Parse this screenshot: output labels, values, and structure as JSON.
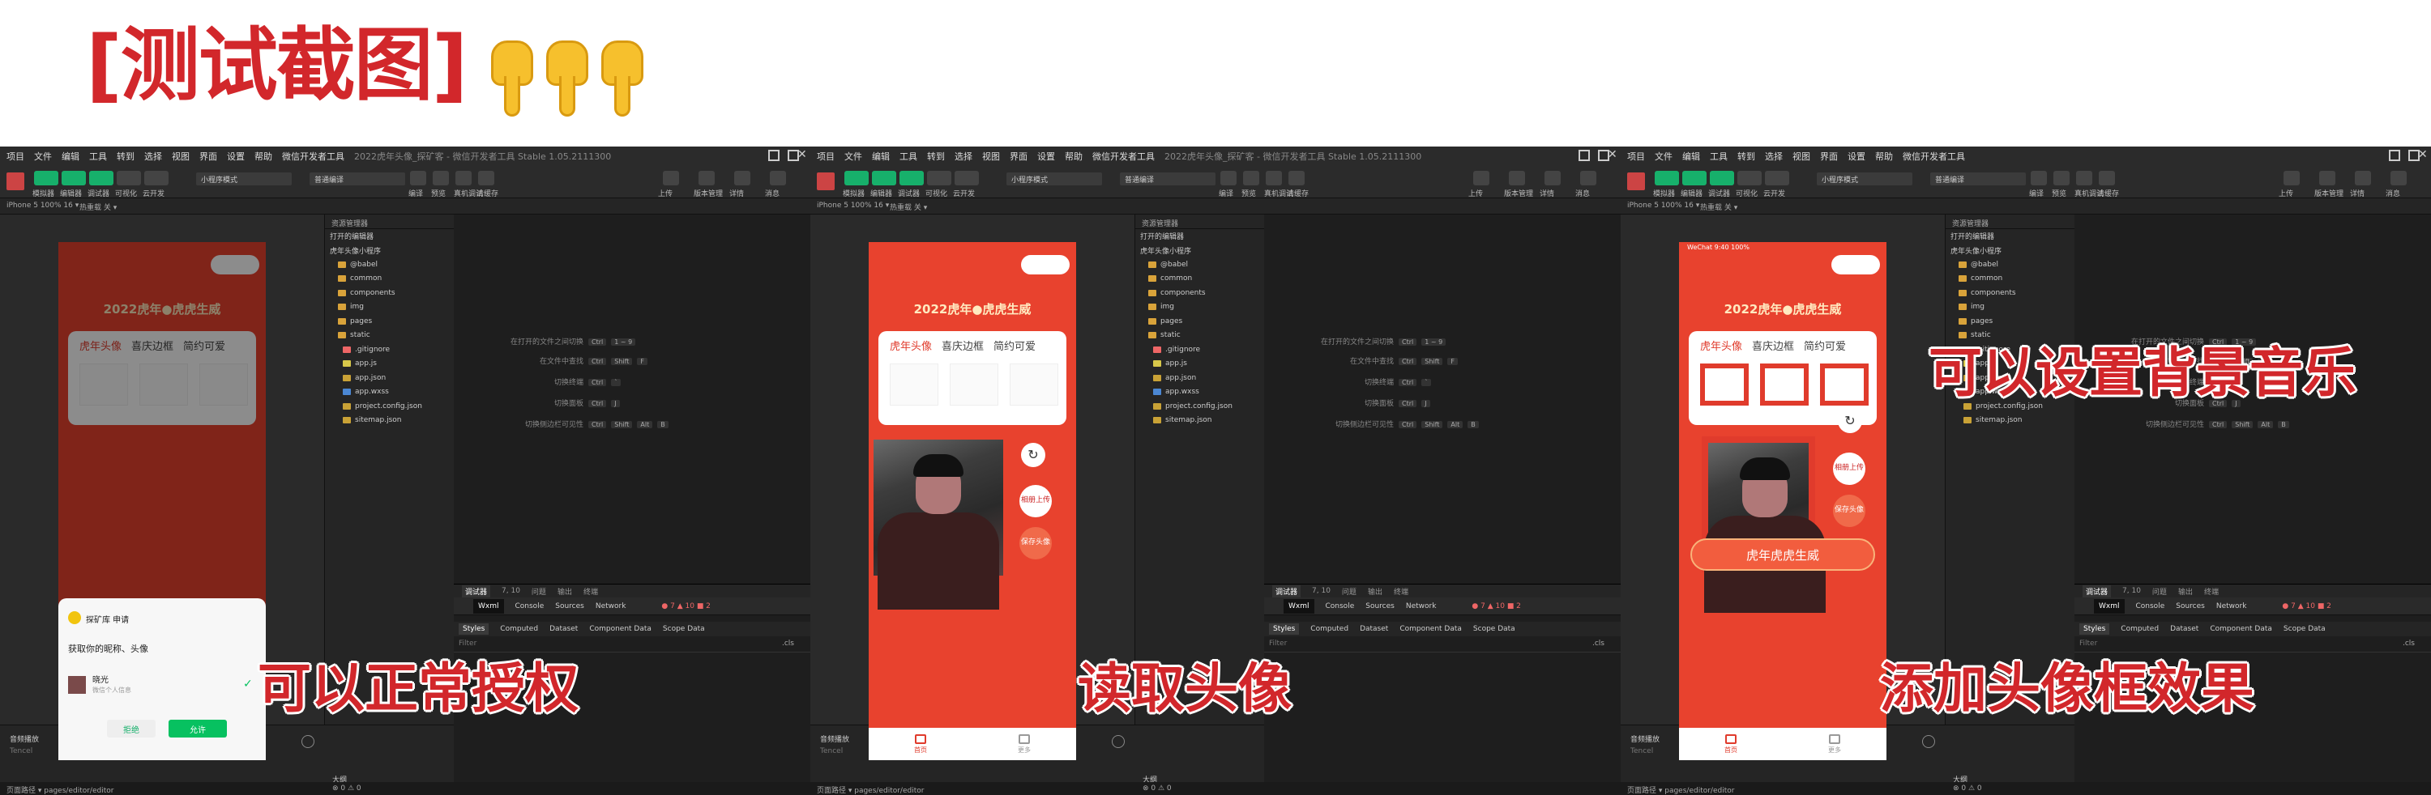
{
  "header": {
    "title": "[测试截图]",
    "hand_icon": "pointing-down-hand-icon"
  },
  "ide": {
    "menu": [
      "项目",
      "文件",
      "编辑",
      "工具",
      "转到",
      "选择",
      "视图",
      "界面",
      "设置",
      "帮助",
      "微信开发者工具"
    ],
    "toolbar_left": [
      "模拟器",
      "编辑器",
      "调试器",
      "可视化",
      "云开发"
    ],
    "mode_select": "小程序模式",
    "compile_select": "普通编译",
    "toolbar_mid": [
      "编译",
      "预览",
      "真机调试",
      "清缓存"
    ],
    "toolbar_right": [
      "上传",
      "版本管理",
      "详情",
      "消息"
    ],
    "device": "iPhone 5 100% 16 ▾",
    "hot_reload": "热重载 关 ▾",
    "explorer_title": "资源管理器",
    "open_editors": "打开的编辑器",
    "project": "虎年头像小程序",
    "files": [
      {
        "name": "@babel",
        "type": "folder"
      },
      {
        "name": "common",
        "type": "folder"
      },
      {
        "name": "components",
        "type": "folder"
      },
      {
        "name": "img",
        "type": "folder"
      },
      {
        "name": "pages",
        "type": "folder"
      },
      {
        "name": "static",
        "type": "folder"
      },
      {
        "name": ".gitignore",
        "type": "git"
      },
      {
        "name": "app.js",
        "type": "js"
      },
      {
        "name": "app.json",
        "type": "json"
      },
      {
        "name": "app.wxss",
        "type": "wxss"
      },
      {
        "name": "project.config.json",
        "type": "json"
      },
      {
        "name": "sitemap.json",
        "type": "json"
      }
    ],
    "shortcuts": [
      {
        "label": "在打开的文件之间切换",
        "keys": [
          "Ctrl",
          "1 ~ 9"
        ]
      },
      {
        "label": "在文件中查找",
        "keys": [
          "Ctrl",
          "Shift",
          "F"
        ]
      },
      {
        "label": "切换终端",
        "keys": [
          "Ctrl",
          "`"
        ]
      },
      {
        "label": "切换面板",
        "keys": [
          "Ctrl",
          "J"
        ]
      },
      {
        "label": "切换侧边栏可见性",
        "keys": [
          "Ctrl",
          "Shift",
          "Alt",
          "B"
        ]
      }
    ],
    "debug_tabs": [
      "调试器",
      "7, 10",
      "问题",
      "输出",
      "终端"
    ],
    "panel_tabs": [
      "Wxml",
      "Console",
      "Sources",
      "Network"
    ],
    "counts": "● 7 ▲ 10 ■ 2",
    "style_tabs": [
      "Styles",
      "Computed",
      "Dataset",
      "Component Data",
      "Scope Data"
    ],
    "filter": "Filter",
    "cls": ".cls",
    "outline": "大纲",
    "music_label": "音频播放",
    "music_sub": "Tencel",
    "status_path": "页面路径 ▾  pages/editor/editor",
    "status_counts": "⊗ 0 ⚠ 0"
  },
  "panels": [
    {
      "window_title": "2022虎年头像_探矿客 - 微信开发者工具 Stable 1.05.2111300",
      "caption": "可以正常授权",
      "app": {
        "title": "2022虎年●虎虎生威",
        "tabs": [
          "虎年头像",
          "喜庆边框",
          "简约可爱"
        ],
        "dialog": {
          "app_name": "探矿库 申请",
          "request": "获取你的昵称、头像",
          "user_name": "晓光",
          "user_hint": "微信个人信息",
          "deny": "拒绝",
          "allow": "允许"
        }
      }
    },
    {
      "window_title": "2022虎年头像_探矿客 - 微信开发者工具 Stable 1.05.2111300",
      "caption": "读取头像",
      "app": {
        "title": "2022虎年●虎虎生威",
        "tabs": [
          "虎年头像",
          "喜庆边框",
          "简约可爱"
        ],
        "buttons": [
          "相册上传",
          "保存头像"
        ],
        "nav": [
          "首页",
          "更多"
        ]
      }
    },
    {
      "window_title": "",
      "caption_top": "可以设置背景音乐",
      "caption": "添加头像框效果",
      "app": {
        "status": "WeChat 9:40 100%",
        "title": "2022虎年●虎虎生威",
        "tabs": [
          "虎年头像",
          "喜庆边框",
          "简约可爱"
        ],
        "buttons": [
          "相册上传",
          "保存头像"
        ],
        "big_button": "虎年虎虎生威",
        "nav": [
          "首页",
          "更多"
        ]
      }
    }
  ],
  "colors": {
    "brand_red": "#d2272b",
    "app_red": "#e8422e",
    "wechat_green": "#07c160"
  }
}
